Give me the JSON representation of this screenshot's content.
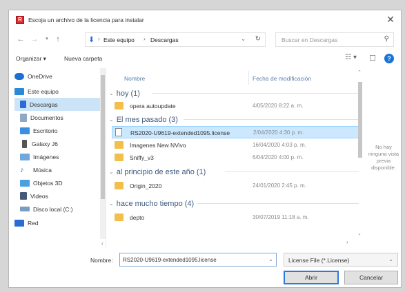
{
  "window": {
    "title": "Escoja un archivo de la licencia para instalar"
  },
  "address": {
    "crumbs": [
      "Este equipo",
      "Descargas"
    ],
    "search_placeholder": "Buscar en Descargas"
  },
  "toolbar": {
    "organize": "Organizar ▾",
    "new_folder": "Nueva carpeta"
  },
  "nav": {
    "items": [
      {
        "label": "OneDrive",
        "icon": "cloud-icon",
        "color": "#1e6fd4"
      },
      {
        "label": "Este equipo",
        "icon": "computer-icon",
        "color": "#2b8ad8"
      },
      {
        "label": "Descargas",
        "icon": "download-icon",
        "color": "#2b6cd4",
        "selected": true
      },
      {
        "label": "Documentos",
        "icon": "documents-icon",
        "color": "#8fa8c4"
      },
      {
        "label": "Escritorio",
        "icon": "desktop-icon",
        "color": "#3a8fe0"
      },
      {
        "label": "Galaxy J6",
        "icon": "phone-icon",
        "color": "#555555"
      },
      {
        "label": "Imágenes",
        "icon": "images-icon",
        "color": "#6fa8dc"
      },
      {
        "label": "Música",
        "icon": "music-icon",
        "color": "#2b6cd4"
      },
      {
        "label": "Objetos 3D",
        "icon": "3d-objects-icon",
        "color": "#4aa0e0"
      },
      {
        "label": "Videos",
        "icon": "videos-icon",
        "color": "#455a78"
      },
      {
        "label": "Disco local (C:)",
        "icon": "drive-icon",
        "color": "#7a9cc0"
      },
      {
        "label": "Red",
        "icon": "network-icon",
        "color": "#2b6cd4"
      }
    ]
  },
  "columns": {
    "name": "Nombre",
    "modified": "Fecha de modificación"
  },
  "groups": [
    {
      "label": "hoy (1)",
      "files": [
        {
          "name": "opera autoupdate",
          "date": "4/05/2020 8:22 a. m.",
          "type": "folder"
        }
      ]
    },
    {
      "label": "El mes pasado (3)",
      "files": [
        {
          "name": "RS2020-U9619-extended1095.license",
          "date": "2/04/2020 4:30 p. m.",
          "type": "file",
          "selected": true
        },
        {
          "name": "Imagenes New NVivo",
          "date": "16/04/2020 4:03 p. m.",
          "type": "folder"
        },
        {
          "name": "Sniffy_v3",
          "date": "6/04/2020 4:00 p. m.",
          "type": "folder"
        }
      ]
    },
    {
      "label": "al principio de este año (1)",
      "files": [
        {
          "name": "Origin_2020",
          "date": "24/01/2020 2:45 p. m.",
          "type": "folder"
        }
      ]
    },
    {
      "label": "hace mucho tiempo (4)",
      "files": [
        {
          "name": "depto",
          "date": "30/07/2019 11:18 a. m.",
          "type": "folder"
        }
      ]
    }
  ],
  "preview": {
    "text": "No hay ninguna vista previa disponible."
  },
  "bottom": {
    "filename_label": "Nombre:",
    "filename_value": "RS2020-U9619-extended1095.license",
    "filter_value": "License File (*.License)",
    "open_label": "Abrir",
    "cancel_label": "Cancelar"
  }
}
